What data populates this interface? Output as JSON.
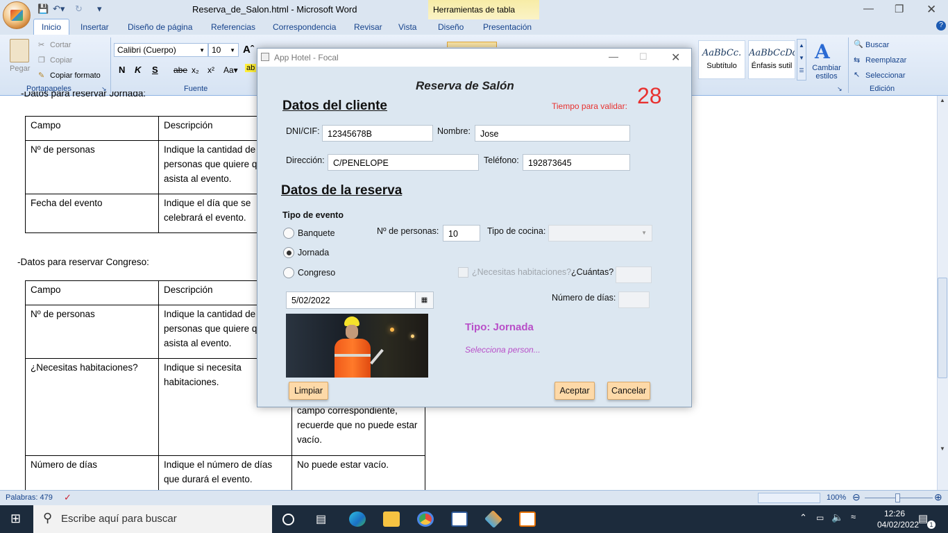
{
  "word": {
    "doc_title": "Reserva_de_Salon.html - Microsoft Word",
    "context_tab": "Herramientas de tabla",
    "tabs": [
      "Inicio",
      "Insertar",
      "Diseño de página",
      "Referencias",
      "Correspondencia",
      "Revisar",
      "Vista",
      "Diseño",
      "Presentación"
    ],
    "clipboard": {
      "paste": "Pegar",
      "cut": "Cortar",
      "copy": "Copiar",
      "format_painter": "Copiar formato",
      "group": "Portapapeles"
    },
    "font": {
      "name": "Calibri (Cuerpo)",
      "size": "10",
      "group": "Fuente"
    },
    "styles": [
      {
        "sample": "AaBbCc.",
        "name": "Subtítulo"
      },
      {
        "sample": "AaBbCcDd",
        "name": "Énfasis sutil"
      }
    ],
    "change_styles": "Cambiar estilos",
    "editing": {
      "find": "Buscar",
      "replace": "Reemplazar",
      "select": "Seleccionar",
      "group": "Edición"
    },
    "doc": {
      "partial_line": "-Datos para reservar Jornada:",
      "table1": [
        [
          "Campo",
          "Descripción"
        ],
        [
          "Nº de personas",
          "Indique la cantidad de personas que quiere que asista al evento."
        ],
        [
          "Fecha del evento",
          "Indique el día que se celebrará el evento."
        ]
      ],
      "congreso_heading": "-Datos para reservar Congreso:",
      "table2": [
        [
          "Campo",
          "Descripción",
          ""
        ],
        [
          "Nº de personas",
          "Indique la cantidad de personas que quiere que asista al evento.",
          ""
        ],
        [
          "¿Necesitas habitaciones?",
          "Indique si necesita habitaciones.",
          "campo correspondiente, recuerde que no puede estar vacío."
        ],
        [
          "Número de días",
          "Indique el número de días que durará el evento.",
          "No puede estar vacío."
        ]
      ]
    },
    "status": {
      "words": "Palabras: 479",
      "zoom": "100%"
    }
  },
  "taskbar": {
    "search_placeholder": "Escribe aquí para buscar",
    "time": "12:26",
    "date": "04/02/2022",
    "notifications": "1"
  },
  "dialog": {
    "window_title": "App Hotel - Focal",
    "title": "Reserva de Salón",
    "timer_label": "Tiempo para validar:",
    "timer_value": "28",
    "client_section": "Datos del cliente",
    "dni_label": "DNI/CIF:",
    "dni_value": "12345678B",
    "name_label": "Nombre:",
    "name_value": "Jose",
    "address_label": "Dirección:",
    "address_value": "C/PENELOPE",
    "phone_label": "Teléfono:",
    "phone_value": "192873645",
    "reservation_section": "Datos de la reserva",
    "event_type_label": "Tipo de evento",
    "event_types": [
      {
        "label": "Banquete",
        "selected": false
      },
      {
        "label": "Jornada",
        "selected": true
      },
      {
        "label": "Congreso",
        "selected": false
      }
    ],
    "people_label": "Nº de personas:",
    "people_value": "10",
    "cuisine_label": "Tipo de cocina:",
    "rooms_label": "¿Necesitas habitaciones?",
    "how_many_label": "¿Cuántas?",
    "days_label": "Número de días:",
    "date_value": "5/02/2022",
    "type_summary": "Tipo: Jornada",
    "hint": "Selecciona person...",
    "clear_button": "Limpiar",
    "accept_button": "Aceptar",
    "cancel_button": "Cancelar",
    "accent_color": "#b84fc8",
    "timer_color": "#e8312f"
  }
}
